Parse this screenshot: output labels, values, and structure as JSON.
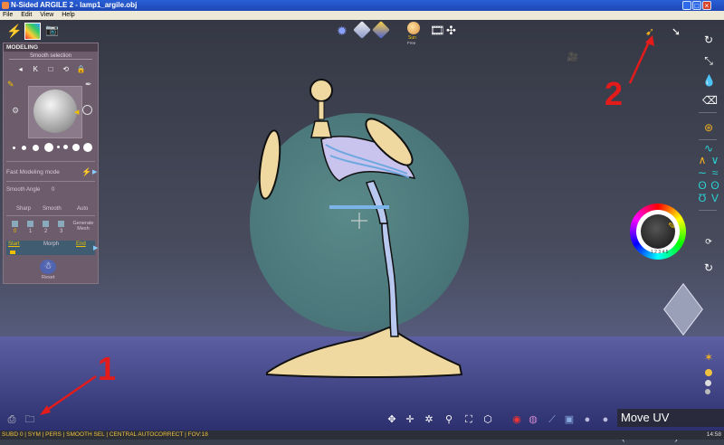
{
  "window": {
    "title": "N-Sided ARGILE 2 - lamp1_argile.obj",
    "menu": [
      "File",
      "Edit",
      "View",
      "Help"
    ]
  },
  "left_panel": {
    "section_title": "MODELING",
    "subsection": "Smooth selection",
    "fast_modeling": "Fast Modeling mode",
    "smooth_angle_label": "Smooth Angle",
    "smooth_angle_value": "0",
    "smooth_options": [
      "Sharp",
      "Smooth",
      "Auto"
    ],
    "subdiv_levels": [
      "0",
      "1",
      "2",
      "3"
    ],
    "generate_mesh": "Generate Mesh",
    "morph_label": "Morph",
    "morph_start": "Start",
    "morph_end": "End",
    "reset_label": "Reset"
  },
  "top_toolbar": {
    "sun_label": "Sun",
    "sun_sub": "Free"
  },
  "annotations": {
    "one": "1",
    "two": "2"
  },
  "tooltip": {
    "text": "Move UV",
    "shortcut": "(SHIFT+G)"
  },
  "color_wheel": {
    "presets": "1 2 3 4 5"
  },
  "status_bar": {
    "text": "SUBD 0 | SYM | PERS | SMOOTH SEL | CENTRAL AUTOCORRECT | FOV:18",
    "time": "14:58"
  },
  "colors": {
    "accent_annotation": "#e31b1b",
    "status_text": "#f0c040",
    "tool_cyan": "#2ad4d4",
    "tool_orange": "#f0b020"
  }
}
